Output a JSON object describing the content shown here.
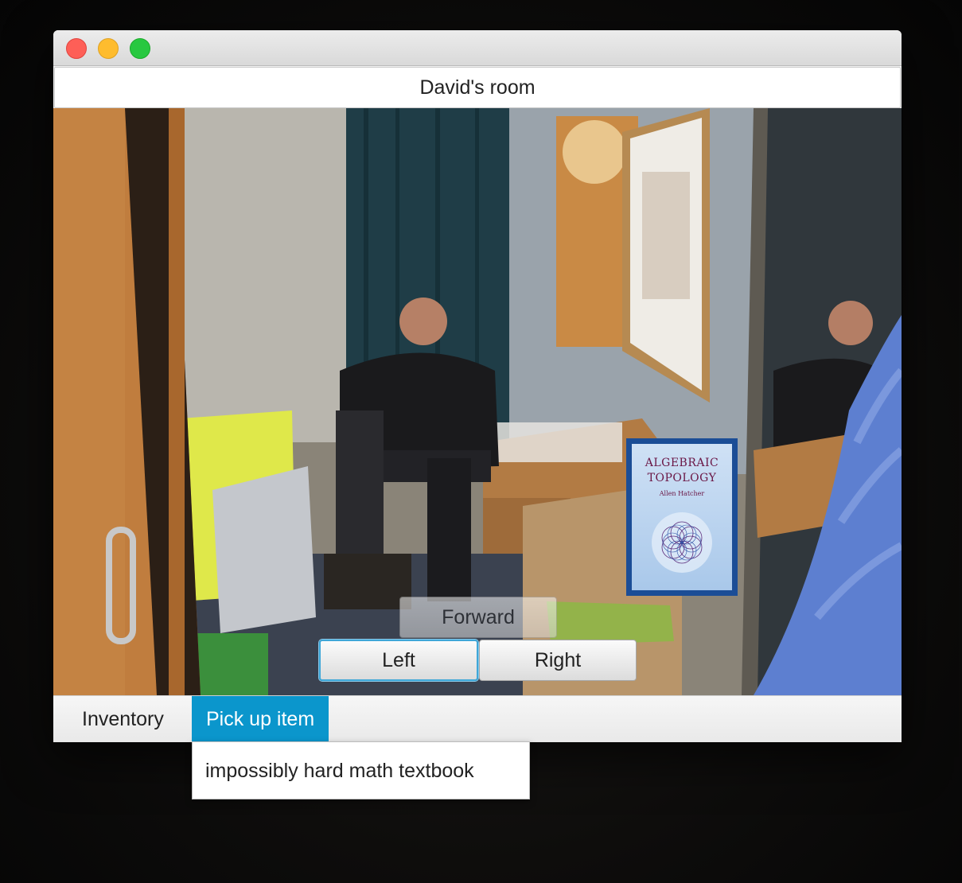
{
  "window": {
    "room_title": "David's room"
  },
  "scene": {
    "book": {
      "title_line1": "ALGEBRAIC",
      "title_line2": "TOPOLOGY",
      "author": "Allen Hatcher"
    }
  },
  "navigation": {
    "forward_label": "Forward",
    "left_label": "Left",
    "right_label": "Right"
  },
  "menubar": {
    "inventory_label": "Inventory",
    "pickup_label": "Pick up item"
  },
  "dropdown": {
    "items": [
      "impossibly hard math textbook"
    ]
  },
  "colors": {
    "accent": "#0b96cc",
    "focus_ring": "#3fa7d8",
    "book_frame": "#1b4d96"
  }
}
